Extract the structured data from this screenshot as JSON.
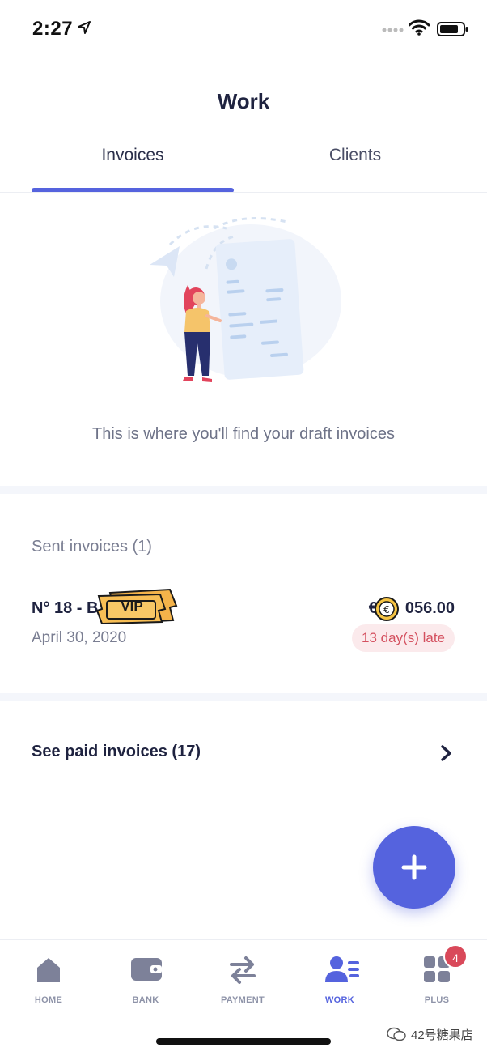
{
  "status_bar": {
    "time": "2:27"
  },
  "header": {
    "title": "Work"
  },
  "tabs": [
    {
      "label": "Invoices",
      "active": true
    },
    {
      "label": "Clients",
      "active": false
    }
  ],
  "empty_state": {
    "text": "This is where you'll find your draft invoices"
  },
  "sent_invoices": {
    "header": "Sent invoices (1)",
    "items": [
      {
        "number": "N° 18 - B",
        "badge": "VIP",
        "date": "April 30, 2020",
        "amount_prefix": "€",
        "amount": "056.00",
        "status": "13 day(s) late"
      }
    ]
  },
  "paid": {
    "label": "See paid invoices (17)"
  },
  "bottom_nav": {
    "items": [
      {
        "label": "HOME",
        "icon": "home-icon",
        "active": false
      },
      {
        "label": "BANK",
        "icon": "wallet-icon",
        "active": false
      },
      {
        "label": "PAYMENT",
        "icon": "transfer-icon",
        "active": false
      },
      {
        "label": "WORK",
        "icon": "work-icon",
        "active": true
      },
      {
        "label": "PLUS",
        "icon": "grid-icon",
        "active": false
      }
    ],
    "plus_badge": "4"
  },
  "watermark": "42号糖果店",
  "colors": {
    "accent": "#5563de",
    "late_bg": "#fbeaec",
    "late_text": "#d4505f",
    "badge": "#d9495a"
  }
}
